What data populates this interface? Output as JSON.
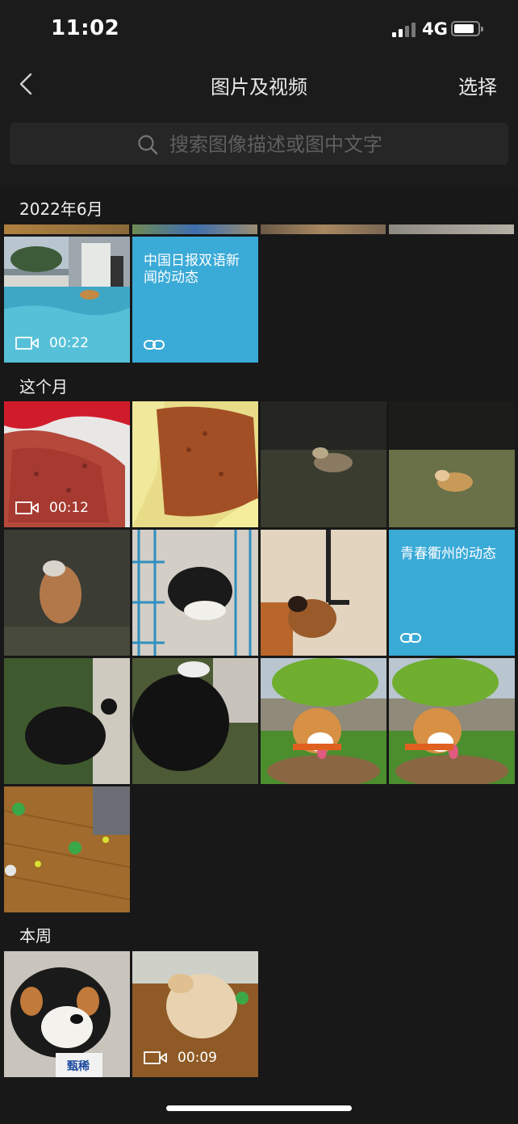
{
  "status_bar": {
    "time": "11:02",
    "network": "4G"
  },
  "nav": {
    "title": "图片及视频",
    "select_label": "选择"
  },
  "search": {
    "placeholder": "搜索图像描述或图中文字"
  },
  "sections": {
    "june": {
      "title": "2022年6月",
      "items": [
        {
          "type": "video",
          "duration": "00:22"
        },
        {
          "type": "link",
          "text": "中国日报双语新闻的动态"
        }
      ]
    },
    "this_month": {
      "title": "这个月",
      "items": [
        {
          "type": "video",
          "duration": "00:12"
        },
        {
          "type": "photo"
        },
        {
          "type": "photo"
        },
        {
          "type": "photo"
        },
        {
          "type": "photo"
        },
        {
          "type": "photo"
        },
        {
          "type": "photo"
        },
        {
          "type": "link",
          "text": "青春衢州的动态"
        },
        {
          "type": "photo"
        },
        {
          "type": "photo"
        },
        {
          "type": "photo"
        },
        {
          "type": "photo"
        },
        {
          "type": "photo"
        }
      ]
    },
    "this_week": {
      "title": "本周",
      "items": [
        {
          "type": "photo",
          "caption": "甄稀"
        },
        {
          "type": "video",
          "duration": "00:09"
        }
      ]
    }
  },
  "colors": {
    "link_card": "#3aaad7",
    "background": "#1b1b1b"
  }
}
